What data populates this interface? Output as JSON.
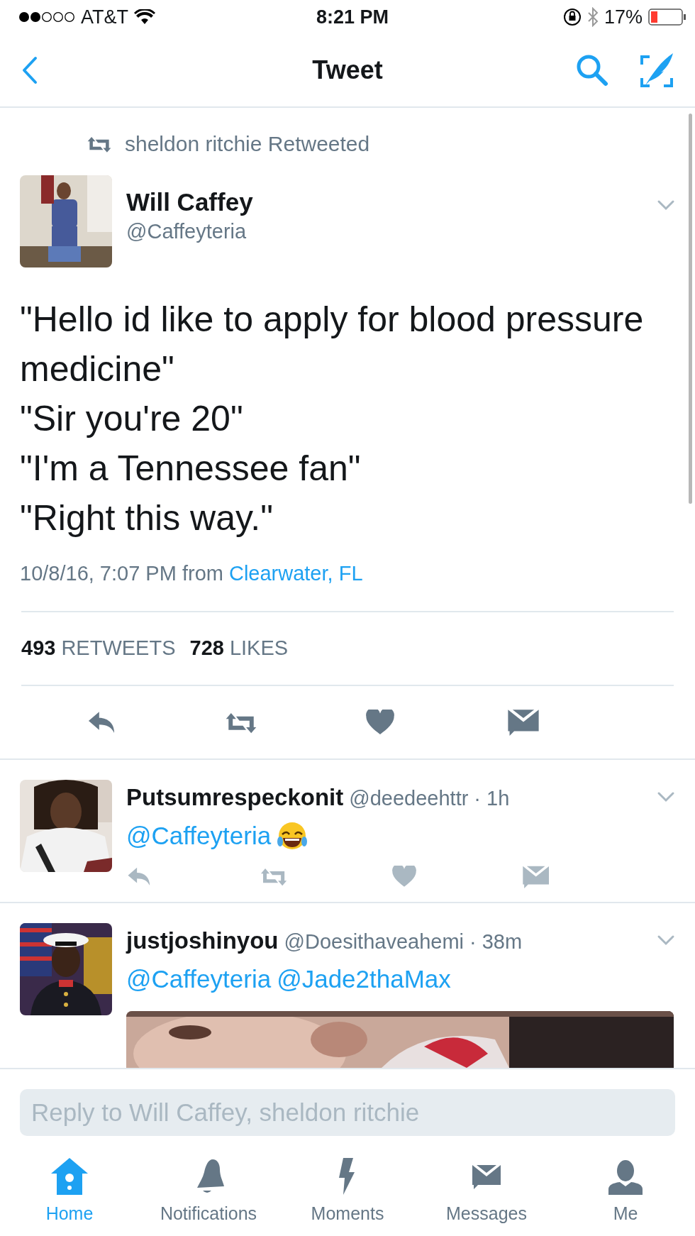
{
  "status_bar": {
    "carrier": "AT&T",
    "time": "8:21 PM",
    "battery": "17%"
  },
  "nav": {
    "title": "Tweet"
  },
  "tweet": {
    "retweeted_by": "sheldon ritchie Retweeted",
    "author": "Will Caffey",
    "handle": "@Caffeyteria",
    "lines": [
      "\"Hello id like to apply for blood pressure medicine\"",
      "\"Sir you're 20\"",
      "\"I'm a Tennessee fan\"",
      "\"Right this way.\""
    ],
    "timestamp": "10/8/16, 7:07 PM from",
    "location": "Clearwater, FL",
    "stats": [
      {
        "count": "493",
        "label": "RETWEETS"
      },
      {
        "count": "728",
        "label": "LIKES"
      }
    ]
  },
  "replies": [
    {
      "name": "Putsumrespeckonit",
      "handle": "@deedeehttr",
      "time": "· 1h",
      "mentions": [
        "@Caffeyteria"
      ],
      "emoji": true,
      "media": false
    },
    {
      "name": "justjoshinyou",
      "handle": "@Doesithaveahemi",
      "time": "· 38m",
      "mentions": [
        "@Caffeyteria",
        "@Jade2thaMax"
      ],
      "emoji": false,
      "media": true
    }
  ],
  "reply_field": {
    "placeholder": "Reply to Will Caffey, sheldon ritchie"
  },
  "tab_bar": [
    {
      "label": "Home",
      "selected": true,
      "kind": "home"
    },
    {
      "label": "Notifications",
      "selected": false,
      "kind": "bell"
    },
    {
      "label": "Moments",
      "selected": false,
      "kind": "bolt"
    },
    {
      "label": "Messages",
      "selected": false,
      "kind": "mail"
    },
    {
      "label": "Me",
      "selected": false,
      "kind": "person"
    }
  ]
}
